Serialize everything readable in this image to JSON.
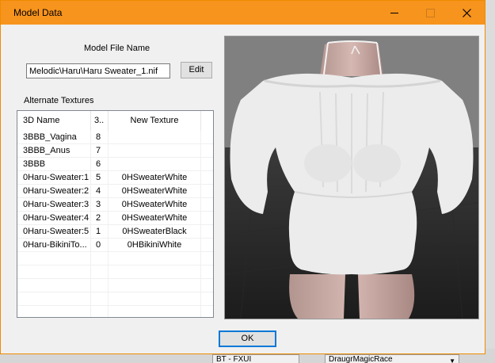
{
  "window": {
    "title": "Model Data"
  },
  "model_file": {
    "label": "Model File Name",
    "value": "Melodic\\Haru\\Haru Sweater_1.nif",
    "edit_label": "Edit"
  },
  "textures": {
    "label": "Alternate Textures",
    "columns": [
      "3D Name",
      "3..",
      "New Texture"
    ],
    "rows": [
      {
        "name": "3BBB_Vagina",
        "index": "8",
        "texture": ""
      },
      {
        "name": "3BBB_Anus",
        "index": "7",
        "texture": ""
      },
      {
        "name": "3BBB",
        "index": "6",
        "texture": ""
      },
      {
        "name": "0Haru-Sweater:1",
        "index": "5",
        "texture": "0HSweaterWhite"
      },
      {
        "name": "0Haru-Sweater:2",
        "index": "4",
        "texture": "0HSweaterWhite"
      },
      {
        "name": "0Haru-Sweater:3",
        "index": "3",
        "texture": "0HSweaterWhite"
      },
      {
        "name": "0Haru-Sweater:4",
        "index": "2",
        "texture": "0HSweaterWhite"
      },
      {
        "name": "0Haru-Sweater:5",
        "index": "1",
        "texture": "0HSweaterBlack"
      },
      {
        "name": "0Haru-BikiniTo...",
        "index": "0",
        "texture": "0HBikiniWhite"
      },
      {
        "name": "",
        "index": "",
        "texture": ""
      },
      {
        "name": "",
        "index": "",
        "texture": ""
      },
      {
        "name": "",
        "index": "",
        "texture": ""
      },
      {
        "name": "",
        "index": "",
        "texture": ""
      },
      {
        "name": "",
        "index": "",
        "texture": ""
      }
    ]
  },
  "ok_label": "OK",
  "background": {
    "field_left": "BT - FXUI",
    "field_right": "DraugrMagicRace"
  },
  "icons": {
    "minimize": "minimize-icon",
    "maximize": "maximize-icon",
    "close": "close-icon",
    "dropdown": "chevron-down-icon"
  },
  "colors": {
    "titlebar": "#f7941d",
    "ok_focus": "#0078d7"
  }
}
